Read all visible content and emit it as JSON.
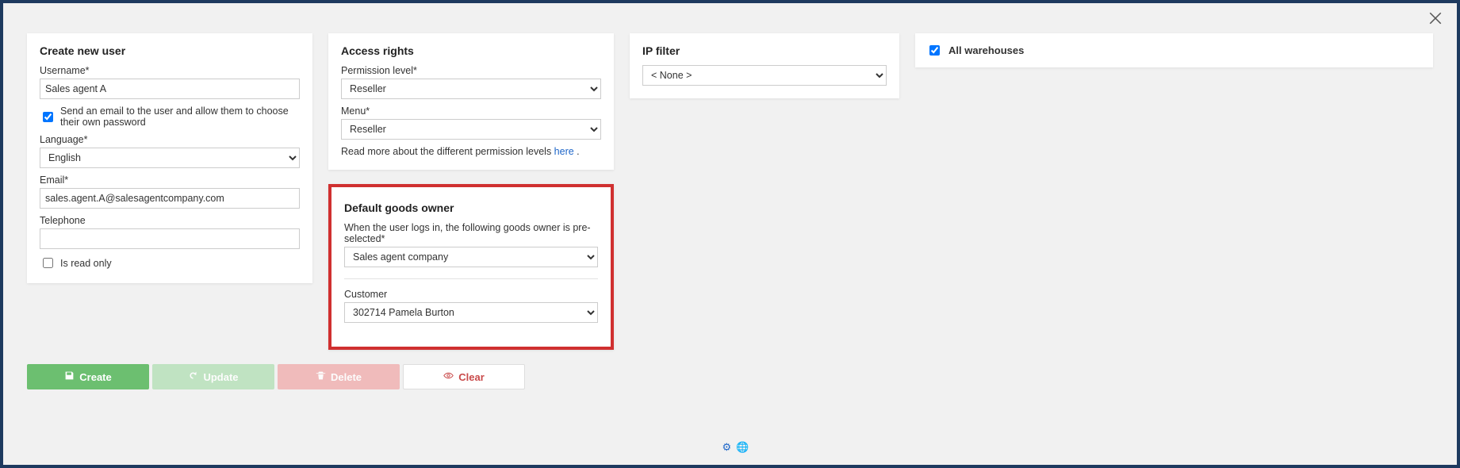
{
  "close_title": "Close",
  "create_user": {
    "title": "Create new user",
    "username_label": "Username*",
    "username_value": "Sales agent A",
    "send_email_label": "Send an email to the user and allow them to choose their own password",
    "send_email_checked": true,
    "language_label": "Language*",
    "language_value": "English",
    "email_label": "Email*",
    "email_value": "sales.agent.A@salesagentcompany.com",
    "telephone_label": "Telephone",
    "telephone_value": "",
    "readonly_label": "Is read only",
    "readonly_checked": false
  },
  "access_rights": {
    "title": "Access rights",
    "permission_label": "Permission level*",
    "permission_value": "Reseller",
    "menu_label": "Menu*",
    "menu_value": "Reseller",
    "help_prefix": "Read more about the different permission levels ",
    "help_link": "here",
    "help_suffix": " ."
  },
  "default_goods_owner": {
    "title": "Default goods owner",
    "preselect_label": "When the user logs in, the following goods owner is pre-selected*",
    "goods_owner_value": "Sales agent company",
    "customer_label": "Customer",
    "customer_value": "302714    Pamela Burton"
  },
  "ip_filter": {
    "title": "IP filter",
    "value": "< None >"
  },
  "warehouses": {
    "all_label": "All warehouses",
    "all_checked": true
  },
  "buttons": {
    "create": "Create",
    "update": "Update",
    "delete": "Delete",
    "clear": "Clear"
  }
}
